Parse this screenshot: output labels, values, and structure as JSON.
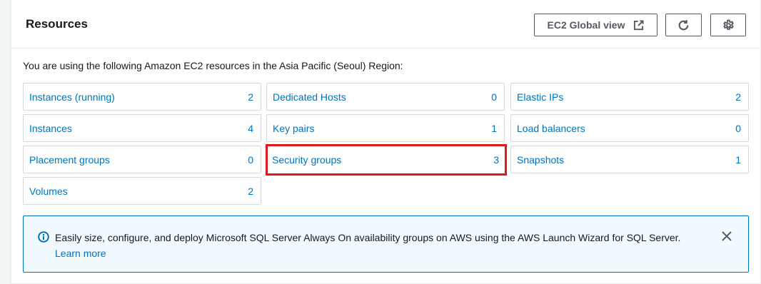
{
  "header": {
    "title": "Resources",
    "global_view_label": "EC2 Global view",
    "global_view_icon": "external-link-icon",
    "refresh_icon": "refresh-icon",
    "settings_icon": "gear-icon"
  },
  "intro_text": "You are using the following Amazon EC2 resources in the Asia Pacific (Seoul) Region:",
  "resources": [
    {
      "label": "Instances (running)",
      "count": "2"
    },
    {
      "label": "Dedicated Hosts",
      "count": "0"
    },
    {
      "label": "Elastic IPs",
      "count": "2"
    },
    {
      "label": "Instances",
      "count": "4"
    },
    {
      "label": "Key pairs",
      "count": "1"
    },
    {
      "label": "Load balancers",
      "count": "0"
    },
    {
      "label": "Placement groups",
      "count": "0"
    },
    {
      "label": "Security groups",
      "count": "3"
    },
    {
      "label": "Snapshots",
      "count": "1"
    },
    {
      "label": "Volumes",
      "count": "2"
    }
  ],
  "alert": {
    "message": "Easily size, configure, and deploy Microsoft SQL Server Always On availability groups on AWS using the AWS Launch Wizard for SQL Server.",
    "link_label": "Learn more",
    "icon": "info-icon",
    "close_icon": "close-icon"
  },
  "colors": {
    "link": "#0073bb",
    "highlight_border": "#e0191e",
    "alert_bg": "#f1faff"
  }
}
